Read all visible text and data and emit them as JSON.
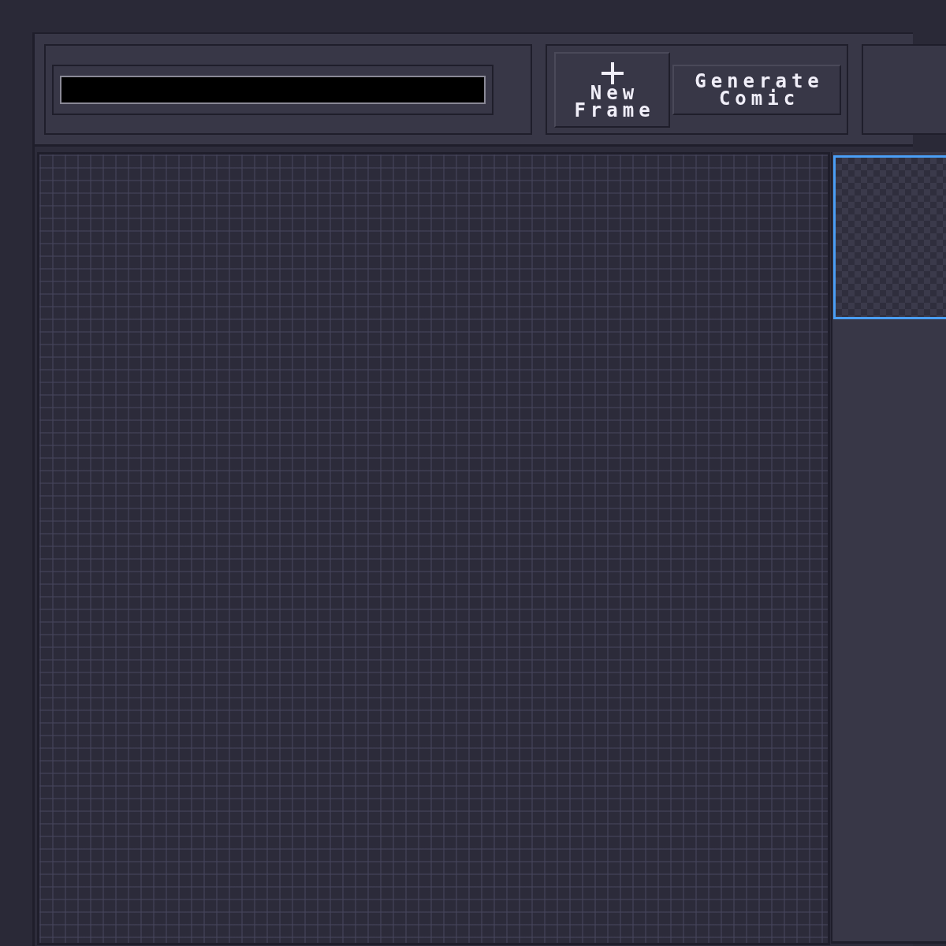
{
  "toolbar": {
    "buttons": [
      {
        "kind": "add",
        "label": "New Frame"
      },
      {
        "kind": "text",
        "label": "Generate Comic"
      }
    ]
  },
  "frames": [
    {
      "selected": true
    }
  ]
}
